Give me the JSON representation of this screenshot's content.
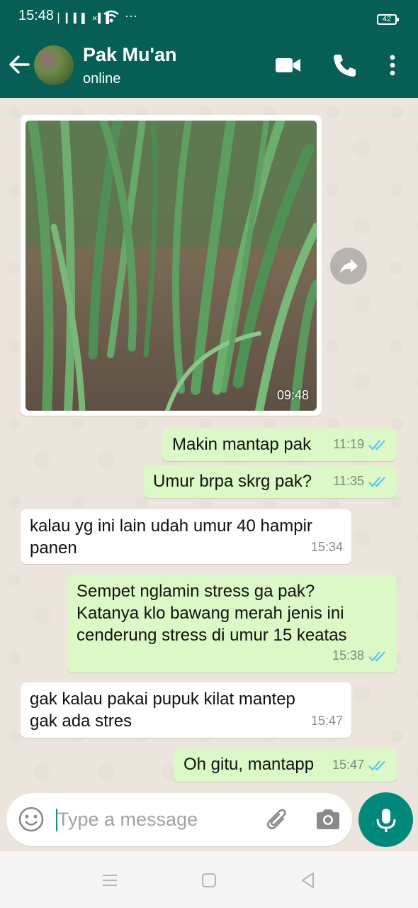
{
  "status_bar": {
    "time": "15:48",
    "signal": "▏▎▍▌ ×▍▌",
    "more": "···",
    "battery": "42"
  },
  "header": {
    "contact_name": "Pak Mu'an",
    "contact_status": "online"
  },
  "messages": [
    {
      "type": "image",
      "direction": "in",
      "time": "09:48",
      "image_description": "green shallot plants"
    },
    {
      "type": "text",
      "direction": "out",
      "text": "Makin mantap pak",
      "time": "11:19",
      "status": "read"
    },
    {
      "type": "text",
      "direction": "out",
      "text": "Umur brpa skrg pak?",
      "time": "11:35",
      "status": "read"
    },
    {
      "type": "text",
      "direction": "in",
      "text": "kalau yg ini lain udah umur 40 hampir\npanen",
      "time": "15:34"
    },
    {
      "type": "text",
      "direction": "out",
      "text": "Sempet nglamin stress ga pak?\nKatanya klo bawang merah jenis ini\ncenderung stress di umur  15 keatas",
      "time": "15:38",
      "status": "read"
    },
    {
      "type": "text",
      "direction": "in",
      "text": "gak kalau pakai pupuk kilat mantep\ngak ada stres",
      "time": "15:47"
    },
    {
      "type": "text",
      "direction": "out",
      "text": "Oh gitu, mantapp",
      "time": "15:47",
      "status": "read"
    }
  ],
  "composer": {
    "placeholder": "Type a message"
  },
  "colors": {
    "header": "#075e54",
    "outgoing_bubble": "#dcf8c6",
    "incoming_bubble": "#ffffff",
    "read_tick": "#4fc3f7",
    "mic_button": "#00897b",
    "chat_bg": "#ece5dd"
  },
  "icons": [
    "back-arrow-icon",
    "video-call-icon",
    "phone-icon",
    "more-vert-icon",
    "forward-icon",
    "emoji-icon",
    "attach-icon",
    "camera-icon",
    "mic-icon"
  ]
}
